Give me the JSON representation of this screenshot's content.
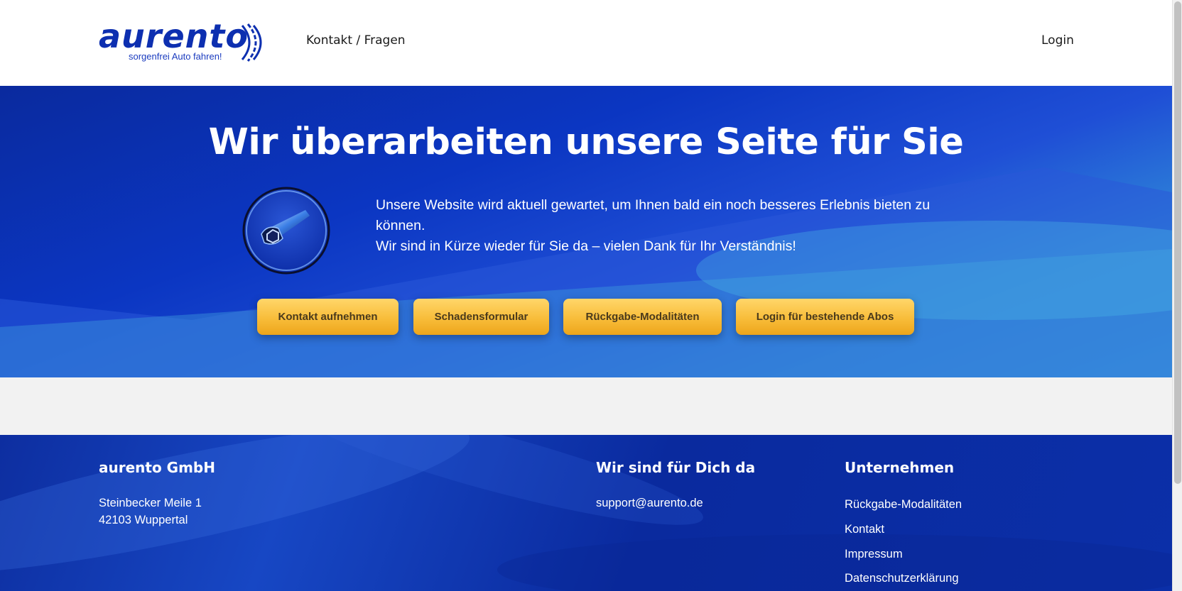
{
  "header": {
    "logo_text": "aurento",
    "logo_tagline": "sorgenfrei Auto fahren!",
    "nav_contact": "Kontakt / Fragen",
    "nav_login": "Login"
  },
  "hero": {
    "title": "Wir überarbeiten unsere Seite für Sie",
    "icon": "wrench-bolt-icon",
    "text_line1": "Unsere Website wird aktuell gewartet, um Ihnen bald ein noch besseres Erlebnis bieten zu können.",
    "text_line2": "Wir sind in Kürze wieder für Sie da – vielen Dank für Ihr Verständnis!",
    "buttons": [
      "Kontakt aufnehmen",
      "Schadensformular",
      "Rückgabe-Modalitäten",
      "Login für bestehende Abos"
    ]
  },
  "footer": {
    "company_heading": "aurento GmbH",
    "address_line1": "Steinbecker Meile 1",
    "address_line2": "42103 Wuppertal",
    "support_heading": "Wir sind für Dich da",
    "support_email": "support@aurento.de",
    "company_links_heading": "Unternehmen",
    "company_links": [
      "Rückgabe-Modalitäten",
      "Kontakt",
      "Impressum",
      "Datenschutzerklärung"
    ]
  },
  "colors": {
    "brand_blue": "#0d2fb0",
    "button_yellow": "#f8bd3a",
    "footer_blue": "#0a2a9e"
  }
}
